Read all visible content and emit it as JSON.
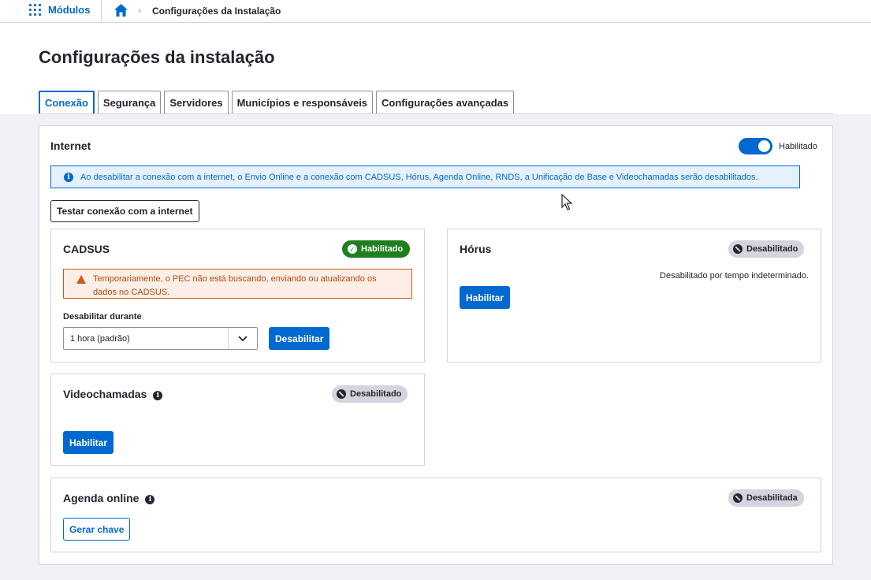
{
  "topbar": {
    "modules_label": "Módulos",
    "breadcrumb": "Configurações da Instalação"
  },
  "page": {
    "title": "Configurações da instalação"
  },
  "tabs": [
    {
      "label": "Conexão",
      "active": true
    },
    {
      "label": "Segurança"
    },
    {
      "label": "Servidores"
    },
    {
      "label": "Municípios e responsáveis"
    },
    {
      "label": "Configurações avançadas"
    }
  ],
  "internet": {
    "title": "Internet",
    "toggle_label": "Habilitado",
    "toggle_on": true,
    "info_text": "Ao desabilitar a conexão com a internet, o Envio Online e a conexão com CADSUS, Hórus, Agenda Online, RNDS, a Unificação de Base e Videochamadas serão desabilitados.",
    "test_button": "Testar conexão com a internet"
  },
  "cadsus": {
    "title": "CADSUS",
    "status": "Habilitado",
    "warning": "Temporariamente, o PEC não está buscando, enviando ou atualizando os dados no CADSUS.",
    "disable_label": "Desabilitar durante",
    "select_value": "1 hora (padrão)",
    "disable_button": "Desabilitar"
  },
  "horus": {
    "title": "Hórus",
    "status": "Desabilitado",
    "description": "Desabilitado por tempo indeterminado.",
    "enable_button": "Habilitar"
  },
  "videochamadas": {
    "title": "Videochamadas",
    "status": "Desabilitado",
    "enable_button": "Habilitar"
  },
  "agenda": {
    "title": "Agenda online",
    "status": "Desabilitada",
    "key_button": "Gerar chave"
  },
  "colors": {
    "primary": "#0069d0",
    "success": "#1e7f1e",
    "warning": "#c95a1a"
  },
  "icons": [
    "grid-icon",
    "home-icon",
    "chevron-right-icon",
    "info-icon",
    "check-icon",
    "warning-icon",
    "block-icon",
    "chevron-down-icon",
    "help-icon"
  ]
}
